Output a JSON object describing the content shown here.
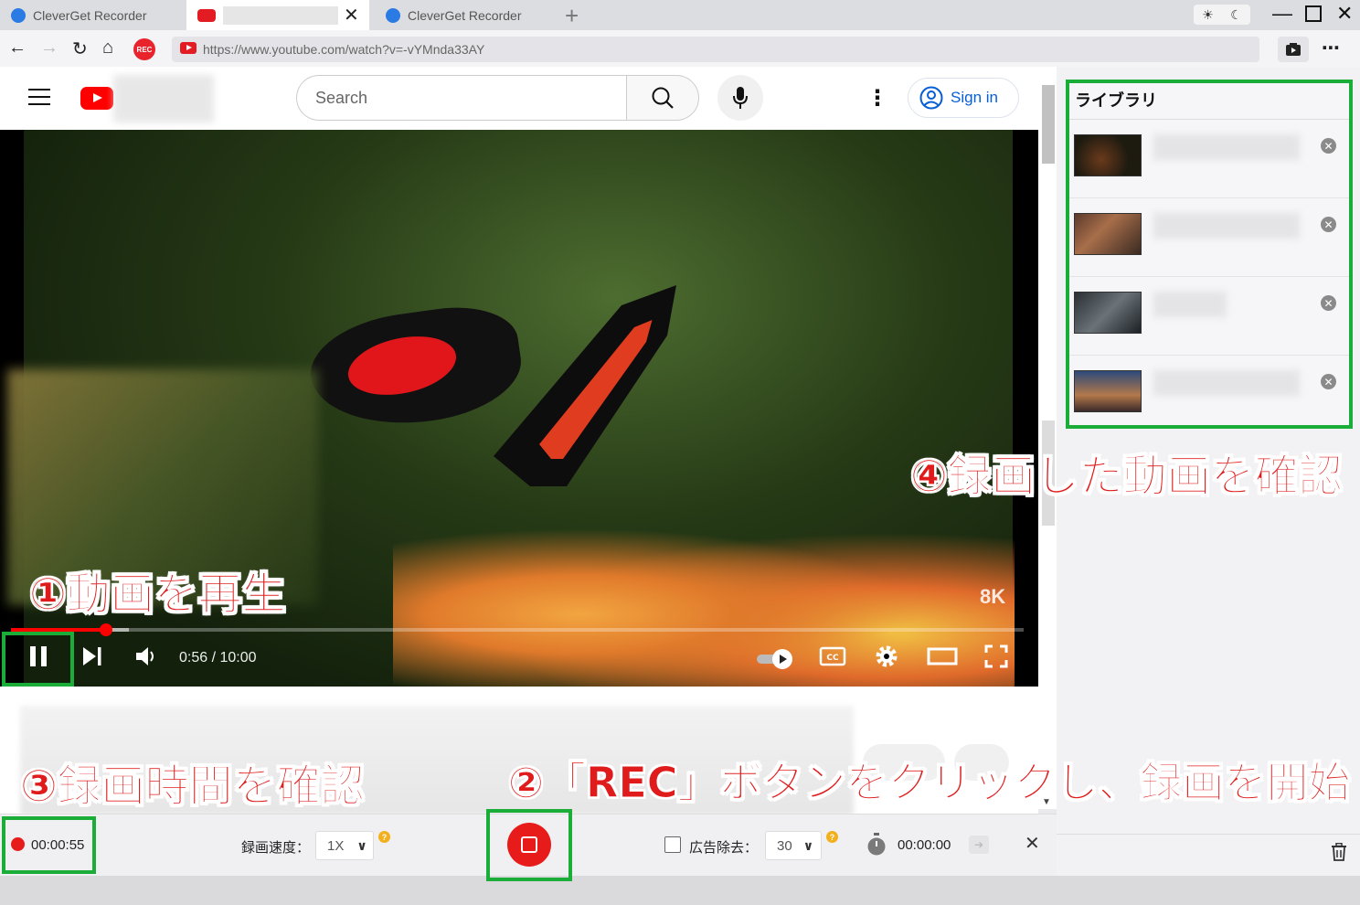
{
  "tabs": [
    {
      "title": "CleverGet Recorder",
      "active": false
    },
    {
      "title": "",
      "active": true
    },
    {
      "title": "CleverGet Recorder",
      "active": false
    }
  ],
  "browser": {
    "url": "https://www.youtube.com/watch?v=-vYMnda33AY",
    "rec_badge": "REC"
  },
  "youtube": {
    "search_placeholder": "Search",
    "sign_in": "Sign in"
  },
  "player": {
    "time": "0:56 / 10:00",
    "progress_fraction": 0.094,
    "buffered_fraction": 0.116,
    "quality_badge": "8K"
  },
  "library": {
    "title": "ライブラリ",
    "items_count": 4
  },
  "recorder": {
    "elapsed": "00:00:55",
    "speed_label": "録画速度：",
    "speed_value": "1X",
    "ad_removal_label": "広告除去：",
    "ad_removal_value": "30",
    "timer_value": "00:00:00",
    "help_mark": "?"
  },
  "annotations": {
    "step1": "①動画を再生",
    "step2": "②「REC」ボタンをクリックし、録画を開始",
    "step3": "③録画時間を確認",
    "step4": "④録画した動画を確認"
  },
  "colors": {
    "annotation_red": "#e01b1b",
    "highlight_green": "#1aad38",
    "youtube_red": "#ff0000",
    "rec_red": "#e81b1b"
  }
}
